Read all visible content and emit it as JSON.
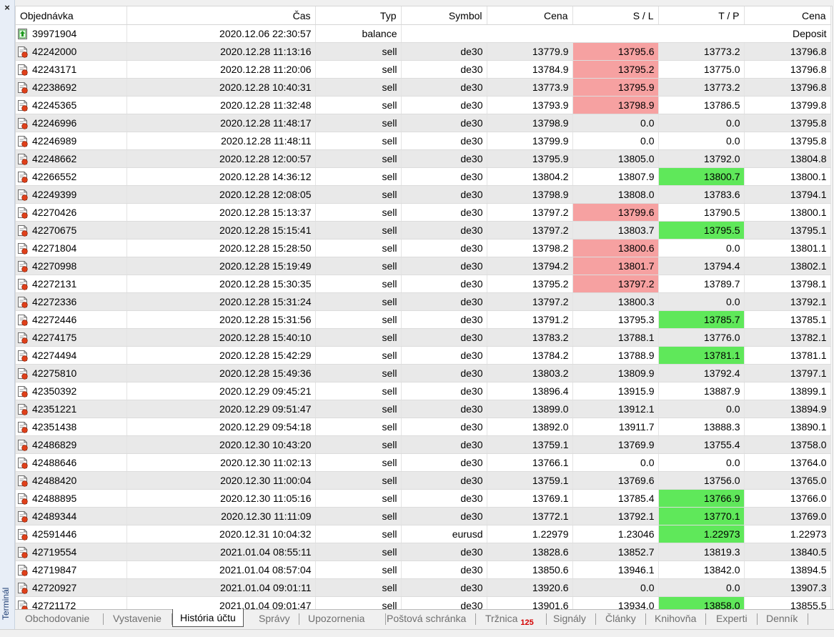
{
  "sidebar": {
    "close_glyph": "×",
    "title": "Terminál"
  },
  "columns": [
    "Objednávka",
    "Čas",
    "Typ",
    "Symbol",
    "Cena",
    "S / L",
    "T / P",
    "Cena"
  ],
  "icons": {
    "balance": "arrow-up-icon",
    "order": "order-document-icon"
  },
  "colors": {
    "sl_hit": "#f6a1a1",
    "tp_hit": "#5fe85a",
    "alt_row": "#e9e9e9",
    "badge": "#d40000"
  },
  "balance_row": {
    "order": "39971904",
    "time": "2020.12.06 22:30:57",
    "type": "balance",
    "comment": "Deposit"
  },
  "rows": [
    {
      "order": "42242000",
      "time": "2020.12.28 11:13:16",
      "type": "sell",
      "symbol": "de30",
      "price": "13779.9",
      "sl": "13795.6",
      "tp": "13773.2",
      "close": "13796.8",
      "hit": "sl"
    },
    {
      "order": "42243171",
      "time": "2020.12.28 11:20:06",
      "type": "sell",
      "symbol": "de30",
      "price": "13784.9",
      "sl": "13795.2",
      "tp": "13775.0",
      "close": "13796.8",
      "hit": "sl"
    },
    {
      "order": "42238692",
      "time": "2020.12.28 10:40:31",
      "type": "sell",
      "symbol": "de30",
      "price": "13773.9",
      "sl": "13795.9",
      "tp": "13773.2",
      "close": "13796.8",
      "hit": "sl"
    },
    {
      "order": "42245365",
      "time": "2020.12.28 11:32:48",
      "type": "sell",
      "symbol": "de30",
      "price": "13793.9",
      "sl": "13798.9",
      "tp": "13786.5",
      "close": "13799.8",
      "hit": "sl"
    },
    {
      "order": "42246996",
      "time": "2020.12.28 11:48:17",
      "type": "sell",
      "symbol": "de30",
      "price": "13798.9",
      "sl": "0.0",
      "tp": "0.0",
      "close": "13795.8",
      "hit": ""
    },
    {
      "order": "42246989",
      "time": "2020.12.28 11:48:11",
      "type": "sell",
      "symbol": "de30",
      "price": "13799.9",
      "sl": "0.0",
      "tp": "0.0",
      "close": "13795.8",
      "hit": ""
    },
    {
      "order": "42248662",
      "time": "2020.12.28 12:00:57",
      "type": "sell",
      "symbol": "de30",
      "price": "13795.9",
      "sl": "13805.0",
      "tp": "13792.0",
      "close": "13804.8",
      "hit": ""
    },
    {
      "order": "42266552",
      "time": "2020.12.28 14:36:12",
      "type": "sell",
      "symbol": "de30",
      "price": "13804.2",
      "sl": "13807.9",
      "tp": "13800.7",
      "close": "13800.1",
      "hit": "tp"
    },
    {
      "order": "42249399",
      "time": "2020.12.28 12:08:05",
      "type": "sell",
      "symbol": "de30",
      "price": "13798.9",
      "sl": "13808.0",
      "tp": "13783.6",
      "close": "13794.1",
      "hit": ""
    },
    {
      "order": "42270426",
      "time": "2020.12.28 15:13:37",
      "type": "sell",
      "symbol": "de30",
      "price": "13797.2",
      "sl": "13799.6",
      "tp": "13790.5",
      "close": "13800.1",
      "hit": "sl"
    },
    {
      "order": "42270675",
      "time": "2020.12.28 15:15:41",
      "type": "sell",
      "symbol": "de30",
      "price": "13797.2",
      "sl": "13803.7",
      "tp": "13795.5",
      "close": "13795.1",
      "hit": "tp"
    },
    {
      "order": "42271804",
      "time": "2020.12.28 15:28:50",
      "type": "sell",
      "symbol": "de30",
      "price": "13798.2",
      "sl": "13800.6",
      "tp": "0.0",
      "close": "13801.1",
      "hit": "sl"
    },
    {
      "order": "42270998",
      "time": "2020.12.28 15:19:49",
      "type": "sell",
      "symbol": "de30",
      "price": "13794.2",
      "sl": "13801.7",
      "tp": "13794.4",
      "close": "13802.1",
      "hit": "sl"
    },
    {
      "order": "42272131",
      "time": "2020.12.28 15:30:35",
      "type": "sell",
      "symbol": "de30",
      "price": "13795.2",
      "sl": "13797.2",
      "tp": "13789.7",
      "close": "13798.1",
      "hit": "sl"
    },
    {
      "order": "42272336",
      "time": "2020.12.28 15:31:24",
      "type": "sell",
      "symbol": "de30",
      "price": "13797.2",
      "sl": "13800.3",
      "tp": "0.0",
      "close": "13792.1",
      "hit": ""
    },
    {
      "order": "42272446",
      "time": "2020.12.28 15:31:56",
      "type": "sell",
      "symbol": "de30",
      "price": "13791.2",
      "sl": "13795.3",
      "tp": "13785.7",
      "close": "13785.1",
      "hit": "tp"
    },
    {
      "order": "42274175",
      "time": "2020.12.28 15:40:10",
      "type": "sell",
      "symbol": "de30",
      "price": "13783.2",
      "sl": "13788.1",
      "tp": "13776.0",
      "close": "13782.1",
      "hit": ""
    },
    {
      "order": "42274494",
      "time": "2020.12.28 15:42:29",
      "type": "sell",
      "symbol": "de30",
      "price": "13784.2",
      "sl": "13788.9",
      "tp": "13781.1",
      "close": "13781.1",
      "hit": "tp"
    },
    {
      "order": "42275810",
      "time": "2020.12.28 15:49:36",
      "type": "sell",
      "symbol": "de30",
      "price": "13803.2",
      "sl": "13809.9",
      "tp": "13792.4",
      "close": "13797.1",
      "hit": ""
    },
    {
      "order": "42350392",
      "time": "2020.12.29 09:45:21",
      "type": "sell",
      "symbol": "de30",
      "price": "13896.4",
      "sl": "13915.9",
      "tp": "13887.9",
      "close": "13899.1",
      "hit": ""
    },
    {
      "order": "42351221",
      "time": "2020.12.29 09:51:47",
      "type": "sell",
      "symbol": "de30",
      "price": "13899.0",
      "sl": "13912.1",
      "tp": "0.0",
      "close": "13894.9",
      "hit": ""
    },
    {
      "order": "42351438",
      "time": "2020.12.29 09:54:18",
      "type": "sell",
      "symbol": "de30",
      "price": "13892.0",
      "sl": "13911.7",
      "tp": "13888.3",
      "close": "13890.1",
      "hit": ""
    },
    {
      "order": "42486829",
      "time": "2020.12.30 10:43:20",
      "type": "sell",
      "symbol": "de30",
      "price": "13759.1",
      "sl": "13769.9",
      "tp": "13755.4",
      "close": "13758.0",
      "hit": ""
    },
    {
      "order": "42488646",
      "time": "2020.12.30 11:02:13",
      "type": "sell",
      "symbol": "de30",
      "price": "13766.1",
      "sl": "0.0",
      "tp": "0.0",
      "close": "13764.0",
      "hit": ""
    },
    {
      "order": "42488420",
      "time": "2020.12.30 11:00:04",
      "type": "sell",
      "symbol": "de30",
      "price": "13759.1",
      "sl": "13769.6",
      "tp": "13756.0",
      "close": "13765.0",
      "hit": ""
    },
    {
      "order": "42488895",
      "time": "2020.12.30 11:05:16",
      "type": "sell",
      "symbol": "de30",
      "price": "13769.1",
      "sl": "13785.4",
      "tp": "13766.9",
      "close": "13766.0",
      "hit": "tp"
    },
    {
      "order": "42489344",
      "time": "2020.12.30 11:11:09",
      "type": "sell",
      "symbol": "de30",
      "price": "13772.1",
      "sl": "13792.1",
      "tp": "13770.1",
      "close": "13769.0",
      "hit": "tp"
    },
    {
      "order": "42591446",
      "time": "2020.12.31 10:04:32",
      "type": "sell",
      "symbol": "eurusd",
      "price": "1.22979",
      "sl": "1.23046",
      "tp": "1.22973",
      "close": "1.22973",
      "hit": "tp"
    },
    {
      "order": "42719554",
      "time": "2021.01.04 08:55:11",
      "type": "sell",
      "symbol": "de30",
      "price": "13828.6",
      "sl": "13852.7",
      "tp": "13819.3",
      "close": "13840.5",
      "hit": ""
    },
    {
      "order": "42719847",
      "time": "2021.01.04 08:57:04",
      "type": "sell",
      "symbol": "de30",
      "price": "13850.6",
      "sl": "13946.1",
      "tp": "13842.0",
      "close": "13894.5",
      "hit": ""
    },
    {
      "order": "42720927",
      "time": "2021.01.04 09:01:11",
      "type": "sell",
      "symbol": "de30",
      "price": "13920.6",
      "sl": "0.0",
      "tp": "0.0",
      "close": "13907.3",
      "hit": ""
    },
    {
      "order": "42721172",
      "time": "2021.01.04 09:01:47",
      "type": "sell",
      "symbol": "de30",
      "price": "13901.6",
      "sl": "13934.0",
      "tp": "13858.0",
      "close": "13855.5",
      "hit": "tp"
    }
  ],
  "tabs": [
    {
      "label": "Obchodovanie",
      "active": false
    },
    {
      "label": "Vystavenie",
      "active": false
    },
    {
      "label": "História účtu",
      "active": true
    },
    {
      "label": "Správy",
      "active": false
    },
    {
      "label": "Upozornenia",
      "active": false
    },
    {
      "label": "Poštová schránka",
      "active": false
    },
    {
      "label": "Tržnica",
      "active": false,
      "badge": "125"
    },
    {
      "label": "Signály",
      "active": false
    },
    {
      "label": "Články",
      "active": false
    },
    {
      "label": "Knihovňa",
      "active": false
    },
    {
      "label": "Experti",
      "active": false
    },
    {
      "label": "Denník",
      "active": false
    }
  ]
}
